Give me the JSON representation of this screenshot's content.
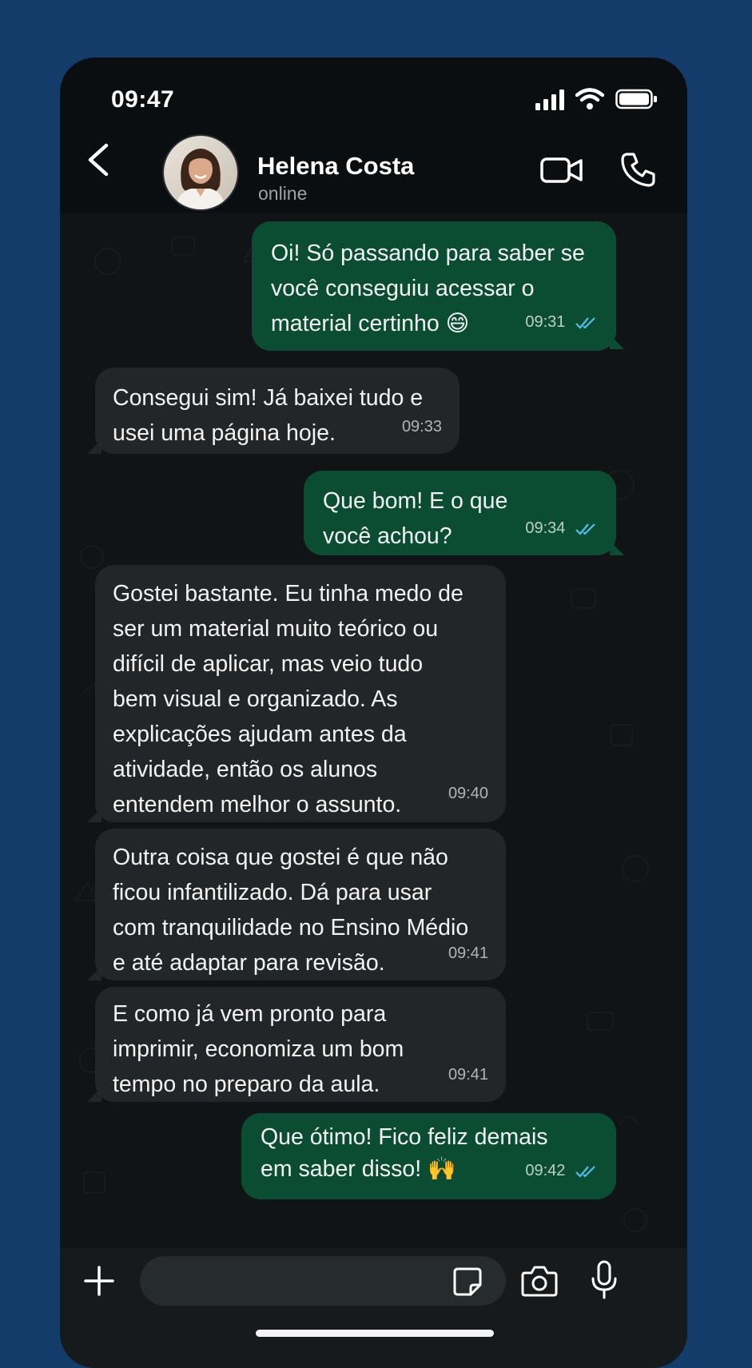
{
  "statusbar": {
    "time": "09:47"
  },
  "header": {
    "contact_name": "Helena Costa",
    "presence": "online"
  },
  "messages": [
    {
      "dir": "out",
      "text": "Oi! Só passando para saber se\nvocê conseguiu acessar o\nmaterial certinho 😄",
      "time": "09:31",
      "read": true
    },
    {
      "dir": "in",
      "text": "Consegui sim! Já baixei tudo e\nusei uma página hoje.",
      "time": "09:33"
    },
    {
      "dir": "out",
      "text": "Que bom! E o que\nvocê achou?",
      "time": "09:34",
      "read": true
    },
    {
      "dir": "in",
      "text": "Gostei bastante. Eu tinha medo de\nser um material muito teórico ou\ndifícil de aplicar, mas veio tudo\nbem visual e organizado. As\nexplicações ajudam antes da\natividade, então os alunos\nentendem melhor o assunto.",
      "time": "09:40"
    },
    {
      "dir": "in",
      "text": "Outra coisa que gostei é que não\nficou infantilizado. Dá para usar\ncom tranquilidade no Ensino Médio\ne até adaptar para revisão.",
      "time": "09:41"
    },
    {
      "dir": "in",
      "text": "E como já vem pronto para\nimprimir, economiza um bom\ntempo no preparo da aula.",
      "time": "09:41"
    },
    {
      "dir": "out",
      "text": "Que ótimo! Fico feliz demais\nem saber disso! 🙌",
      "time": "09:42",
      "read": true
    }
  ],
  "composer": {
    "placeholder": ""
  },
  "colors": {
    "background": "#143c6b",
    "chat_background": "#111416",
    "outgoing_bubble": "#0b4d32",
    "incoming_bubble": "#222628",
    "read_ticks": "#53bdeb"
  },
  "icons": [
    "back-arrow-icon",
    "video-call-icon",
    "phone-call-icon",
    "plus-icon",
    "sticker-icon",
    "camera-icon",
    "microphone-icon",
    "signal-icon",
    "wifi-icon",
    "battery-icon",
    "double-check-icon"
  ]
}
